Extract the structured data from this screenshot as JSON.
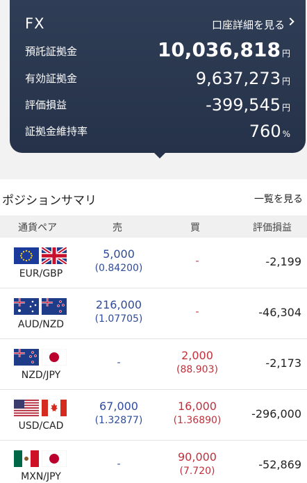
{
  "account": {
    "title": "FX",
    "detail_link": "口座詳細を見る",
    "unit": "円",
    "rows": [
      {
        "label": "預託証拠金",
        "value": "10,036,818",
        "unit": "円"
      },
      {
        "label": "有効証拠金",
        "value": "9,637,273",
        "unit": "円"
      },
      {
        "label": "評価損益",
        "value": "-399,545",
        "unit": "円"
      },
      {
        "label": "証拠金維持率",
        "value": "760",
        "unit": "%"
      }
    ]
  },
  "summary": {
    "title": "ポジションサマリ",
    "view_all": "一覧を見る",
    "columns": [
      "通貨ペア",
      "売",
      "買",
      "評価損益"
    ],
    "rows": [
      {
        "pair": "EUR/GBP",
        "flags": [
          "eu-flag-icon",
          "uk-flag-icon"
        ],
        "sell_qty": "5,000",
        "sell_price": "(0.84200)",
        "buy_qty": "",
        "buy_price": "",
        "buy_dash": "-",
        "sell_dash": "",
        "pl": "-2,199"
      },
      {
        "pair": "AUD/NZD",
        "flags": [
          "australia-flag-icon",
          "new-zealand-flag-icon"
        ],
        "sell_qty": "216,000",
        "sell_price": "(1.07705)",
        "buy_qty": "",
        "buy_price": "",
        "buy_dash": "-",
        "sell_dash": "",
        "pl": "-46,304"
      },
      {
        "pair": "NZD/JPY",
        "flags": [
          "new-zealand-flag-icon",
          "japan-flag-icon"
        ],
        "sell_qty": "",
        "sell_price": "",
        "sell_dash": "-",
        "buy_qty": "2,000",
        "buy_price": "(88.903)",
        "buy_dash": "",
        "pl": "-2,173"
      },
      {
        "pair": "USD/CAD",
        "flags": [
          "usa-flag-icon",
          "canada-flag-icon"
        ],
        "sell_qty": "67,000",
        "sell_price": "(1.32877)",
        "sell_dash": "",
        "buy_qty": "16,000",
        "buy_price": "(1.36890)",
        "buy_dash": "",
        "pl": "-296,000"
      },
      {
        "pair": "MXN/JPY",
        "flags": [
          "mexico-flag-icon",
          "japan-flag-icon"
        ],
        "sell_qty": "",
        "sell_price": "",
        "sell_dash": "-",
        "buy_qty": "90,000",
        "buy_price": "(7.720)",
        "buy_dash": "",
        "pl": "-52,869"
      }
    ]
  }
}
